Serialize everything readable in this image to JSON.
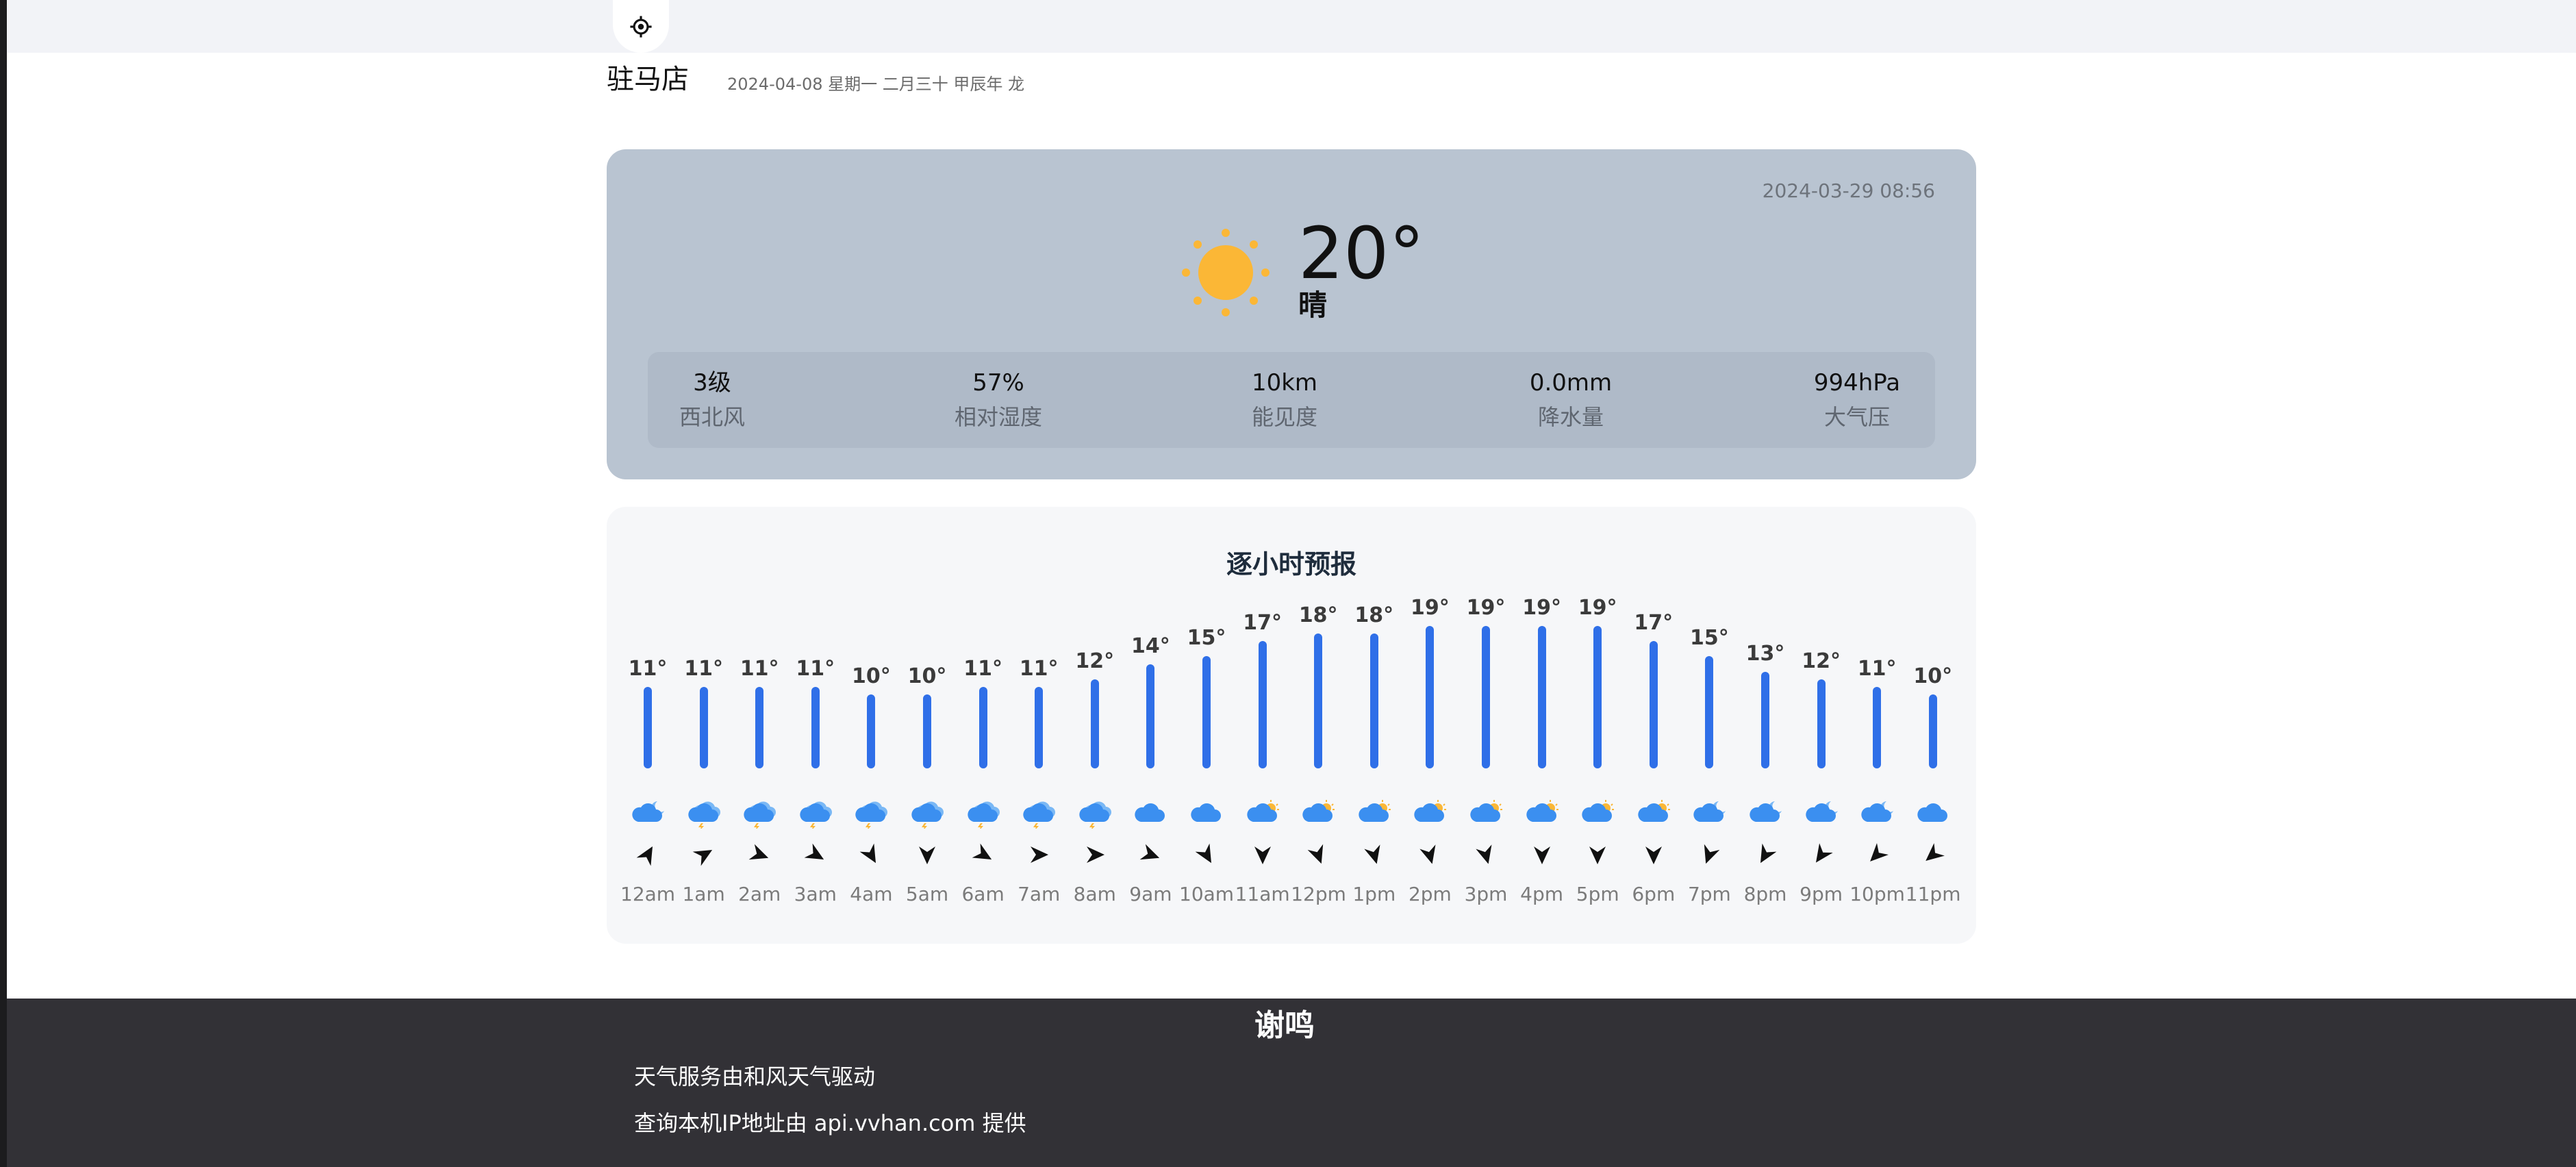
{
  "header": {
    "locate_icon": "crosshair-icon"
  },
  "location": {
    "city": "驻马店",
    "date_line": "2024-04-08 星期一 二月三十 甲辰年 龙"
  },
  "current": {
    "updated": "2024-03-29 08:56",
    "temperature": "20°",
    "condition": "晴",
    "icon": "sun-icon",
    "stats": [
      {
        "value": "3级",
        "label": "西北风"
      },
      {
        "value": "57%",
        "label": "相对湿度"
      },
      {
        "value": "10km",
        "label": "能见度"
      },
      {
        "value": "0.0mm",
        "label": "降水量"
      },
      {
        "value": "994hPa",
        "label": "大气压"
      }
    ]
  },
  "hourly": {
    "title": "逐小时预报",
    "bar_color": "#2f6fe8",
    "hours": [
      {
        "time": "12am",
        "temp": 11,
        "icon": "cloud-moon",
        "wind_deg": 30
      },
      {
        "time": "1am",
        "temp": 11,
        "icon": "thunder",
        "wind_deg": 60
      },
      {
        "time": "2am",
        "temp": 11,
        "icon": "thunder",
        "wind_deg": 110
      },
      {
        "time": "3am",
        "temp": 11,
        "icon": "thunder",
        "wind_deg": 120
      },
      {
        "time": "4am",
        "temp": 10,
        "icon": "thunder",
        "wind_deg": 150
      },
      {
        "time": "5am",
        "temp": 10,
        "icon": "thunder",
        "wind_deg": 180
      },
      {
        "time": "6am",
        "temp": 11,
        "icon": "thunder",
        "wind_deg": 120
      },
      {
        "time": "7am",
        "temp": 11,
        "icon": "thunder",
        "wind_deg": 90
      },
      {
        "time": "8am",
        "temp": 12,
        "icon": "thunder",
        "wind_deg": 90
      },
      {
        "time": "9am",
        "temp": 14,
        "icon": "cloud",
        "wind_deg": 110
      },
      {
        "time": "10am",
        "temp": 15,
        "icon": "cloud",
        "wind_deg": 150
      },
      {
        "time": "11am",
        "temp": 17,
        "icon": "cloud-sun",
        "wind_deg": 180
      },
      {
        "time": "12pm",
        "temp": 18,
        "icon": "cloud-sun",
        "wind_deg": 160
      },
      {
        "time": "1pm",
        "temp": 18,
        "icon": "cloud-sun",
        "wind_deg": 165
      },
      {
        "time": "2pm",
        "temp": 19,
        "icon": "cloud-sun",
        "wind_deg": 165
      },
      {
        "time": "3pm",
        "temp": 19,
        "icon": "cloud-sun",
        "wind_deg": 165
      },
      {
        "time": "4pm",
        "temp": 19,
        "icon": "cloud-sun",
        "wind_deg": 180
      },
      {
        "time": "5pm",
        "temp": 19,
        "icon": "cloud-sun",
        "wind_deg": 180
      },
      {
        "time": "6pm",
        "temp": 17,
        "icon": "cloud-sun",
        "wind_deg": 180
      },
      {
        "time": "7pm",
        "temp": 15,
        "icon": "cloud-moon",
        "wind_deg": 200
      },
      {
        "time": "8pm",
        "temp": 13,
        "icon": "cloud-moon",
        "wind_deg": 210
      },
      {
        "time": "9pm",
        "temp": 12,
        "icon": "cloud-moon",
        "wind_deg": 215
      },
      {
        "time": "10pm",
        "temp": 11,
        "icon": "cloud-moon",
        "wind_deg": 225
      },
      {
        "time": "11pm",
        "temp": 10,
        "icon": "cloud",
        "wind_deg": 230
      }
    ]
  },
  "footer": {
    "title": "谢鸣",
    "lines": [
      "天气服务由和风天气驱动",
      "查询本机IP地址由 api.vvhan.com 提供"
    ]
  }
}
